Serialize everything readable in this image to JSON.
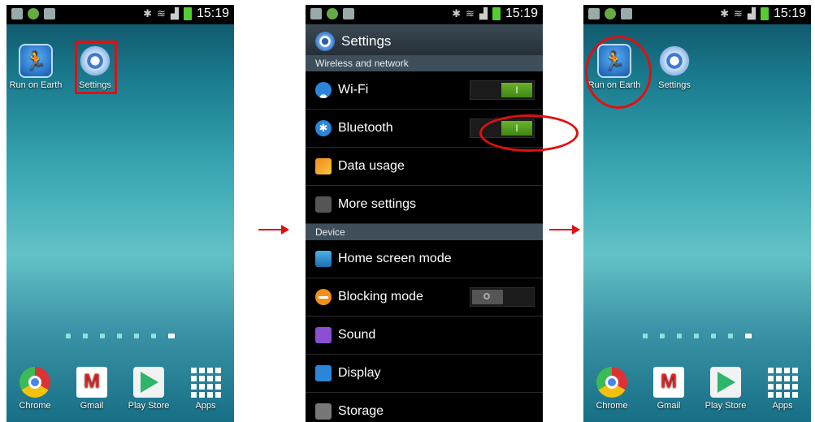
{
  "status_time": "15:19",
  "home1": {
    "apps": [
      {
        "label": "Run on Earth",
        "icon": "runner-icon"
      },
      {
        "label": "Settings",
        "icon": "gear-icon"
      }
    ],
    "dock": [
      {
        "label": "Chrome",
        "icon": "chrome-icon"
      },
      {
        "label": "Gmail",
        "icon": "gmail-icon"
      },
      {
        "label": "Play Store",
        "icon": "play-store-icon"
      },
      {
        "label": "Apps",
        "icon": "apps-grid-icon"
      }
    ],
    "page_count": 7,
    "active_page": 7
  },
  "settings": {
    "title": "Settings",
    "section_wireless": "Wireless and network",
    "section_device": "Device",
    "wifi": "Wi-Fi",
    "wifi_toggle": "I",
    "bluetooth": "Bluetooth",
    "bluetooth_toggle": "I",
    "data_usage": "Data usage",
    "more_settings": "More settings",
    "home_screen_mode": "Home screen mode",
    "blocking_mode": "Blocking mode",
    "sound": "Sound",
    "display": "Display",
    "storage": "Storage",
    "bt_glyph": "✱"
  },
  "home2": {
    "apps": [
      {
        "label": "Run on Earth",
        "icon": "runner-icon"
      },
      {
        "label": "Settings",
        "icon": "gear-icon"
      }
    ],
    "dock": [
      {
        "label": "Chrome",
        "icon": "chrome-icon"
      },
      {
        "label": "Gmail",
        "icon": "gmail-icon"
      },
      {
        "label": "Play Store",
        "icon": "play-store-icon"
      },
      {
        "label": "Apps",
        "icon": "apps-grid-icon"
      }
    ]
  },
  "colors": {
    "highlight": "#e01010",
    "toggle_on": "#5aa620",
    "section_bg": "#3e4e5a"
  }
}
